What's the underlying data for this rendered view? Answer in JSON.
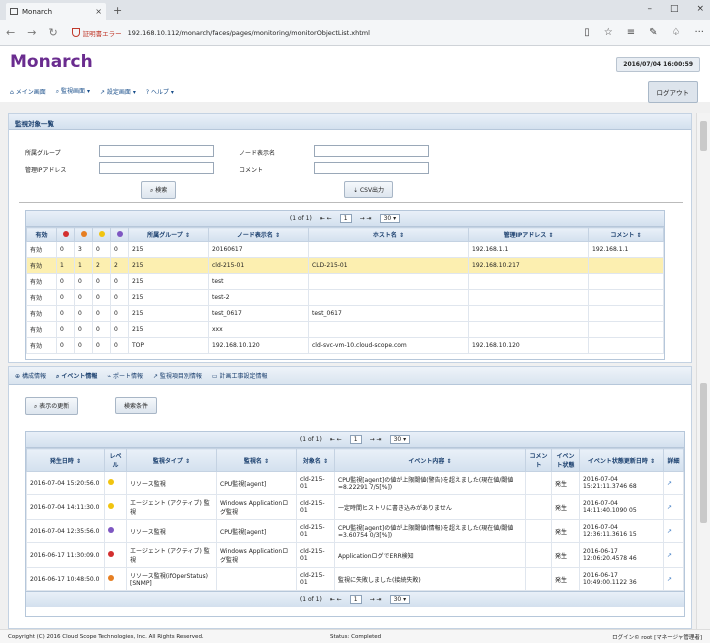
{
  "browser": {
    "tab_title": "Monarch",
    "cert_warning": "証明書エラー",
    "url": "192.168.10.112/monarch/faces/pages/monitoring/monitorObjectList.xhtml"
  },
  "app": {
    "logo": "Monarch",
    "datetime": "2016/07/04 16:00:59",
    "logout_label": "ログアウト",
    "menu": [
      {
        "label": "メイン画面"
      },
      {
        "label": "監視画面"
      },
      {
        "label": "設定画面"
      },
      {
        "label": "ヘルプ"
      }
    ]
  },
  "search_panel": {
    "title": "監視対象一覧",
    "group_label": "所属グループ",
    "node_label": "ノード表示名",
    "ip_label": "管理IPアドレス",
    "comment_label": "コメント",
    "search_button": "検索",
    "csv_button": "CSV出力"
  },
  "objects_table": {
    "pager": {
      "info": "(1 of 1)",
      "page": "1",
      "per_page": "30"
    },
    "headers": {
      "enabled": "有効",
      "group": "所属グループ",
      "node": "ノード表示名",
      "host": "ホスト名",
      "ip": "管理IPアドレス",
      "comment": "コメント"
    },
    "rows": [
      {
        "enabled": "有効",
        "c1": "0",
        "c2": "3",
        "c3": "0",
        "c4": "0",
        "group": "215",
        "node": "20160617",
        "host": "",
        "ip": "192.168.1.1",
        "comment": "192.168.1.1"
      },
      {
        "enabled": "有効",
        "c1": "1",
        "c2": "1",
        "c3": "2",
        "c4": "2",
        "group": "215",
        "node": "cld-215-01",
        "host": "CLD-215-01",
        "ip": "192.168.10.217",
        "comment": ""
      },
      {
        "enabled": "有効",
        "c1": "0",
        "c2": "0",
        "c3": "0",
        "c4": "0",
        "group": "215",
        "node": "test",
        "host": "",
        "ip": "",
        "comment": ""
      },
      {
        "enabled": "有効",
        "c1": "0",
        "c2": "0",
        "c3": "0",
        "c4": "0",
        "group": "215",
        "node": "test-2",
        "host": "",
        "ip": "",
        "comment": ""
      },
      {
        "enabled": "有効",
        "c1": "0",
        "c2": "0",
        "c3": "0",
        "c4": "0",
        "group": "215",
        "node": "test_0617",
        "host": "test_0617",
        "ip": "",
        "comment": ""
      },
      {
        "enabled": "有効",
        "c1": "0",
        "c2": "0",
        "c3": "0",
        "c4": "0",
        "group": "215",
        "node": "xxx",
        "host": "",
        "ip": "",
        "comment": ""
      },
      {
        "enabled": "有効",
        "c1": "0",
        "c2": "0",
        "c3": "0",
        "c4": "0",
        "group": "TOP",
        "node": "192.168.10.120",
        "host": "cld-svc-vm-10.cloud-scope.com",
        "ip": "192.168.10.120",
        "comment": ""
      }
    ]
  },
  "lower_tabs": [
    {
      "label": "構成情報"
    },
    {
      "label": "イベント情報"
    },
    {
      "label": "ポート情報"
    },
    {
      "label": "監視項目別情報"
    },
    {
      "label": "計画工事設定情報"
    }
  ],
  "event_panel": {
    "refresh_button": "表示の更新",
    "filter_button": "検索条件",
    "pager": {
      "info": "(1 of 1)",
      "page": "1",
      "per_page": "30"
    },
    "headers": {
      "date": "発生日時",
      "level": "レベル",
      "type": "監視タイプ",
      "name": "監視名",
      "target": "対象名",
      "content": "イベント内容",
      "comment": "コメント",
      "state": "イベント状態",
      "updated": "イベント状態更新日時",
      "detail": "詳細"
    },
    "rows": [
      {
        "date": "2016-07-04 15:20:56.0",
        "level": "warning",
        "type": "リソース監視",
        "name": "CPU監視[agent]",
        "target": "cld-215-01",
        "content": "CPU監視[agent]の値が上限閾値(警告)を超えました(現在値/閾値=8.22291 7/5[%])",
        "state": "発生",
        "updated": "2016-07-04 15:21:11.3746 68"
      },
      {
        "date": "2016-07-04 14:11:30.0",
        "level": "warning",
        "type": "エージェント (アクティブ) 監視",
        "name": "Windows Applicationログ監視",
        "target": "cld-215-01",
        "content": "一定時間ヒストリに書き込みがありません",
        "state": "発生",
        "updated": "2016-07-04 14:11:40.1090 05"
      },
      {
        "date": "2016-07-04 12:35:56.0",
        "level": "info",
        "type": "リソース監視",
        "name": "CPU監視[agent]",
        "target": "cld-215-01",
        "content": "CPU監視[agent]の値が上限閾値(情報)を超えました(現在値/閾値=3.60754 0/3[%])",
        "state": "発生",
        "updated": "2016-07-04 12:36:11.3616 15"
      },
      {
        "date": "2016-06-17 11:30:09.0",
        "level": "critical",
        "type": "エージェント (アクティブ) 監視",
        "name": "Windows Applicationログ監視",
        "target": "cld-215-01",
        "content": "ApplicationログでERR検知",
        "state": "発生",
        "updated": "2016-06-17 12:06:20.4578 46"
      },
      {
        "date": "2016-06-17 10:48:50.0",
        "level": "error",
        "type": "リソース監視(ifOperStatus)[SNMP]",
        "name": "",
        "target": "cld-215-01",
        "content": "監視に失敗しました(接続失敗)",
        "state": "発生",
        "updated": "2016-06-17 10:49:00.1122 36"
      }
    ]
  },
  "footer": {
    "copyright": "Copyright (C) 2016 Cloud Scope Technologies, Inc. All Rights Reserved.",
    "status": "Status: Completed",
    "login": "ログイン© root [マネージャ管理者]"
  },
  "colors": {
    "brand": "#6a2c8f",
    "highlight": "#fcefb0",
    "critical": "#d32f2f",
    "error": "#e67e22",
    "warning": "#f1c40f",
    "info": "#7e57c2"
  }
}
